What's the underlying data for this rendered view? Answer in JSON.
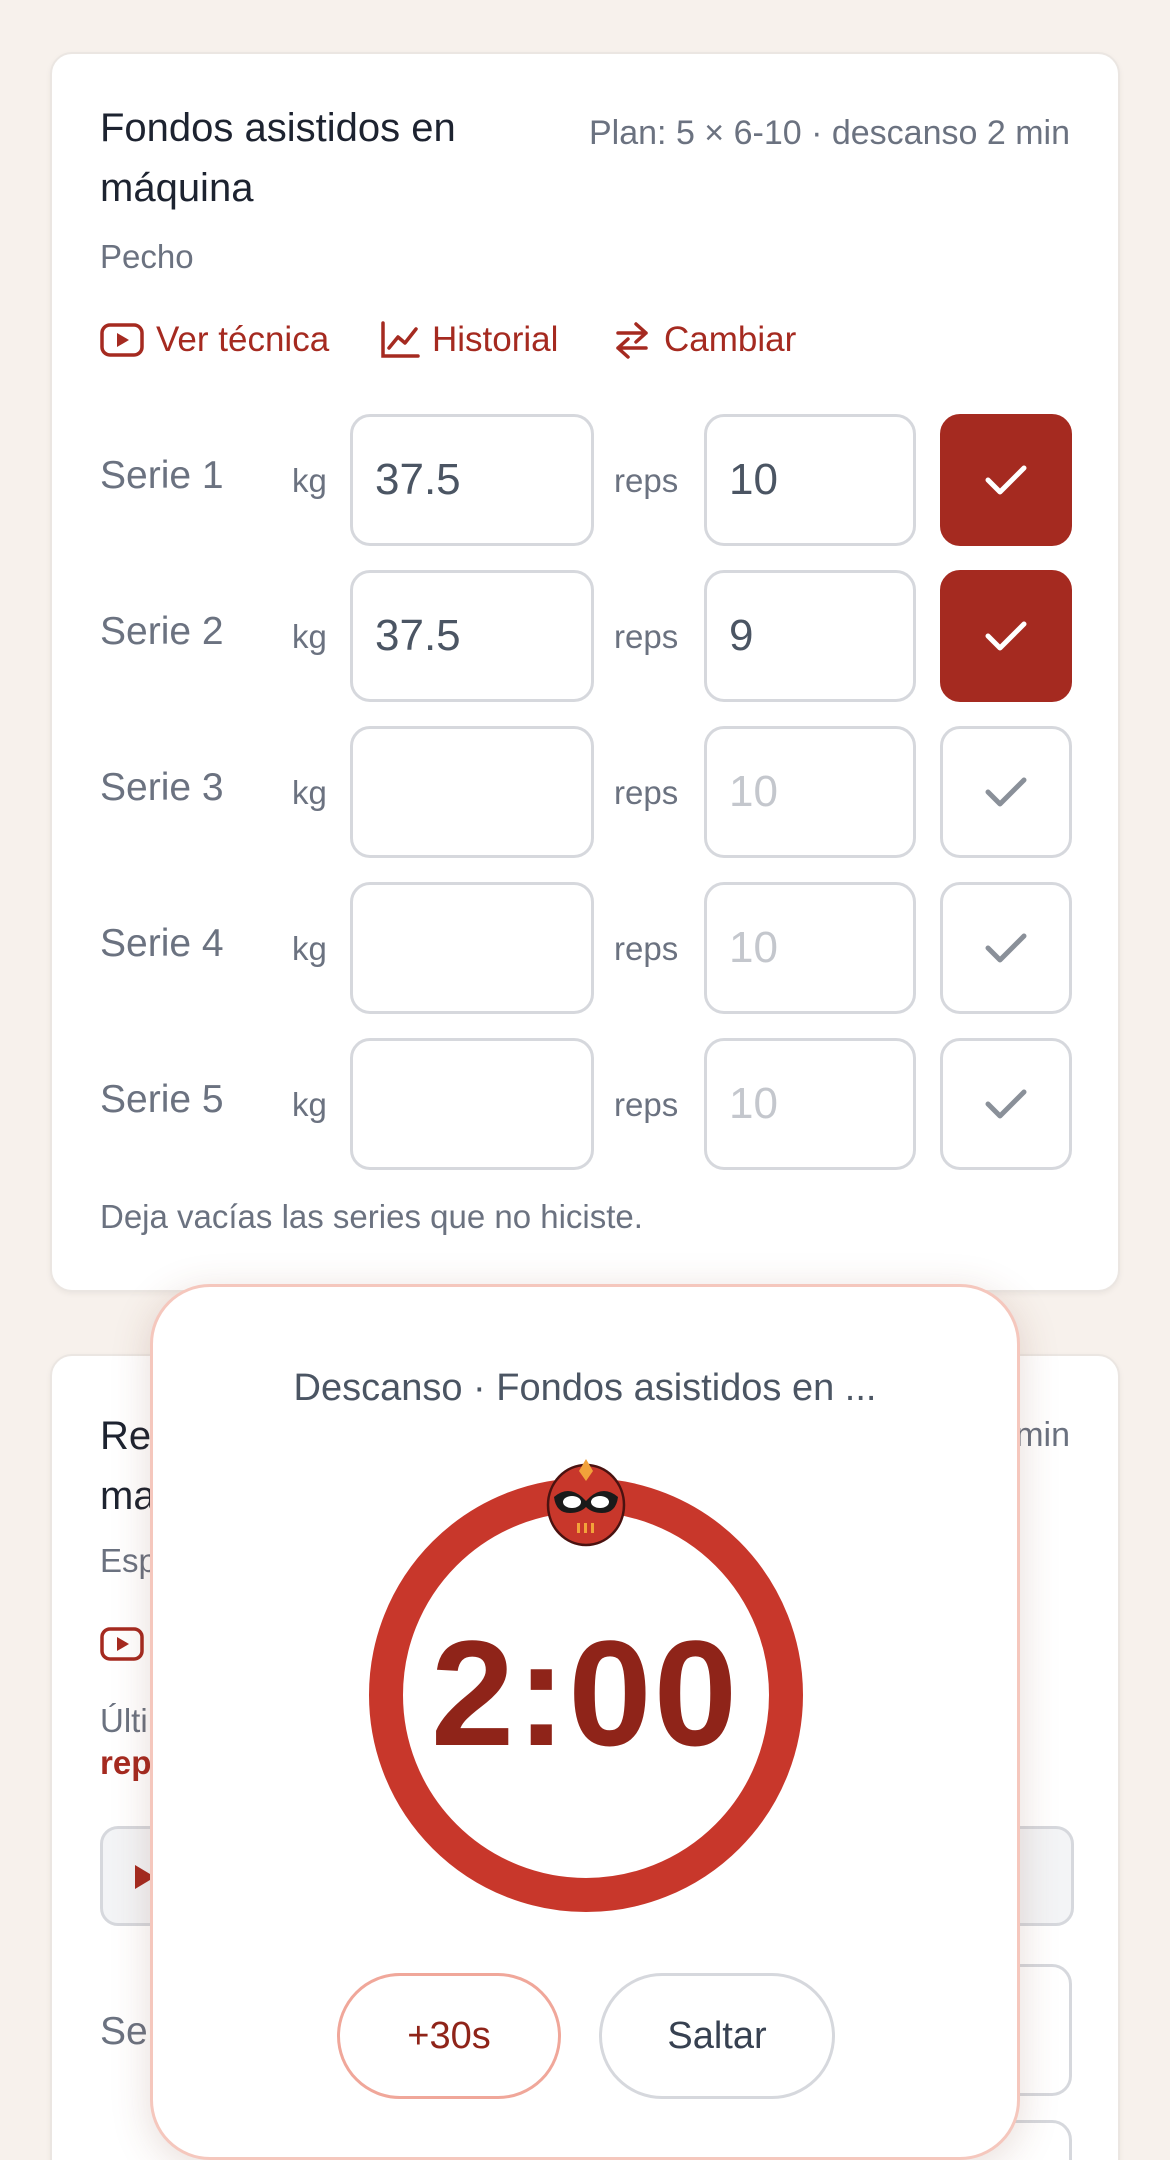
{
  "exercise": {
    "title_line1": "Fondos asistidos en",
    "title_line2": "máquina",
    "plan": "Plan: 5 × 6-10 · descanso 2 min",
    "muscle": "Pecho",
    "actions": {
      "technique": "Ver técnica",
      "history": "Historial",
      "swap": "Cambiar"
    },
    "unit_kg": "kg",
    "unit_reps": "reps",
    "sets": [
      {
        "label": "Serie 1",
        "kg": "37.5",
        "reps": "10",
        "reps_placeholder": "",
        "done": true
      },
      {
        "label": "Serie 2",
        "kg": "37.5",
        "reps": "9",
        "reps_placeholder": "",
        "done": true
      },
      {
        "label": "Serie 3",
        "kg": "",
        "reps": "",
        "reps_placeholder": "10",
        "done": false
      },
      {
        "label": "Serie 4",
        "kg": "",
        "reps": "",
        "reps_placeholder": "10",
        "done": false
      },
      {
        "label": "Serie 5",
        "kg": "",
        "reps": "",
        "reps_placeholder": "10",
        "done": false
      }
    ],
    "hint": "Deja vacías las series que no hiciste."
  },
  "next_exercise": {
    "title_line1": "Re",
    "title_line2": "ma",
    "plan_fragment": "min",
    "muscle": "Esp",
    "last_label": "Últi",
    "rep_label": "rep",
    "serie_label": "Se"
  },
  "rest_timer": {
    "title": "Descanso · Fondos asistidos en ...",
    "time": "2:00",
    "progress": 1.0,
    "add_button": "+30s",
    "skip_button": "Saltar"
  },
  "colors": {
    "accent": "#a52a20",
    "ring": "#c8372b",
    "time": "#8f2419",
    "background": "#f7f1ec"
  }
}
